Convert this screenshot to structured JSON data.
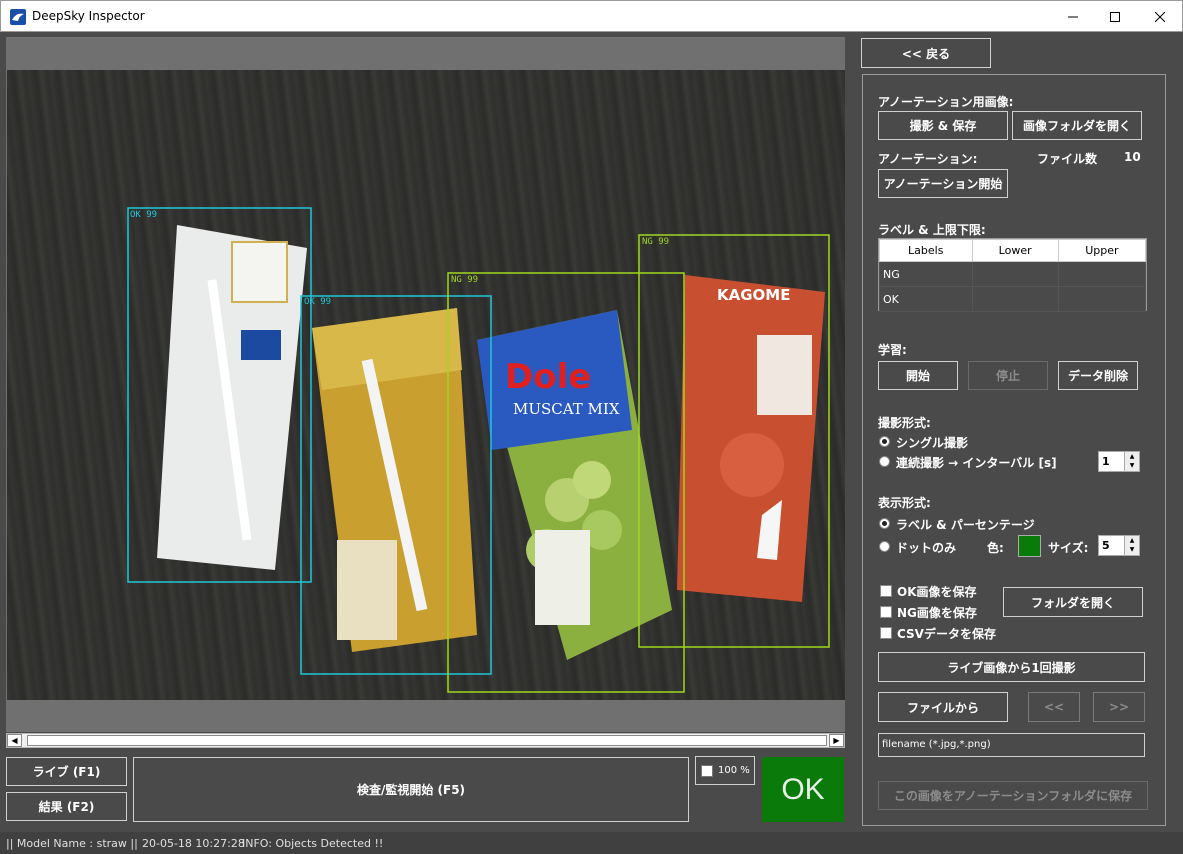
{
  "window": {
    "title": "DeepSky Inspector"
  },
  "detections": [
    {
      "label": "OK 99",
      "color": "#1ec8d8"
    },
    {
      "label": "OK 99",
      "color": "#1ec8d8"
    },
    {
      "label": "NG 99",
      "color": "#a0d81e"
    },
    {
      "label": "NG 99",
      "color": "#a0d81e"
    }
  ],
  "bottom": {
    "live_label": "ライブ (F1)",
    "result_label": "結果 (F2)",
    "inspect_label": "検査/監視開始 (F5)",
    "zoom_label": "100 %",
    "result_value": "OK",
    "result_color": "#0a7a0a"
  },
  "status": {
    "model": "|| Model Name : straw ||",
    "timestamp": "20-05-18 10:27:28",
    "info": "INFO:  Objects Detected !!"
  },
  "panel": {
    "back_label": "<< 戻る",
    "annotation_images_heading": "アノーテーション用画像:",
    "capture_save_label": "撮影 & 保存",
    "open_image_folder_label": "画像フォルダを開く",
    "annotation_heading": "アノーテーション:",
    "file_count_label": "ファイル数",
    "file_count_value": "10",
    "start_annotation_label": "アノーテーション開始",
    "label_limits_heading": "ラベル & 上限下限:",
    "table": {
      "headers": [
        "Labels",
        "Lower",
        "Upper"
      ],
      "rows": [
        [
          "NG",
          "",
          ""
        ],
        [
          "OK",
          "",
          ""
        ]
      ]
    },
    "learning_heading": "学習:",
    "learn_start_label": "開始",
    "learn_stop_label": "停止",
    "delete_data_label": "データ削除",
    "capture_mode_heading": "撮影形式:",
    "single_capture_label": "シングル撮影",
    "continuous_capture_label": "連続撮影 → インターバル [s]",
    "interval_value": "1",
    "display_mode_heading": "表示形式:",
    "label_percent_label": "ラベル & パーセンテージ",
    "dot_only_label": "ドットのみ",
    "color_label": "色:",
    "size_label": "サイズ:",
    "size_value": "5",
    "save_ok_label": "OK画像を保存",
    "save_ng_label": "NG画像を保存",
    "save_csv_label": "CSVデータを保存",
    "open_folder_label": "フォルダを開く",
    "capture_once_label": "ライブ画像から1回撮影",
    "from_file_label": "ファイルから",
    "prev_label": "<<",
    "next_label": ">>",
    "filename_placeholder": "filename (*.jpg,*.png)",
    "save_to_annotation_label": "この画像をアノーテーションフォルダに保存"
  }
}
